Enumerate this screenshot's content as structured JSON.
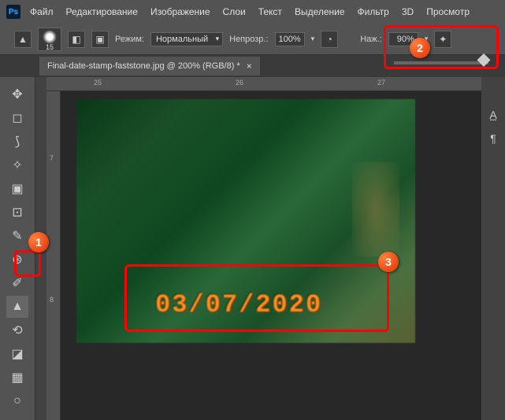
{
  "menu": {
    "items": [
      "Файл",
      "Редактирование",
      "Изображение",
      "Слои",
      "Текст",
      "Выделение",
      "Фильтр",
      "3D",
      "Просмотр"
    ]
  },
  "options": {
    "brush_size": "15",
    "mode_label": "Режим:",
    "mode_value": "Нормальный",
    "opacity_label": "Непрозр.:",
    "opacity_value": "100%",
    "flow_label": "Наж.:",
    "flow_value": "90%"
  },
  "tab": {
    "title": "Final-date-stamp-faststone.jpg @ 200% (RGB/8) *"
  },
  "ruler": {
    "h": [
      "25",
      "26",
      "27"
    ],
    "v": [
      "7",
      "8"
    ]
  },
  "canvas": {
    "date_stamp": "03/07/2020"
  },
  "markers": {
    "m1": "1",
    "m2": "2",
    "m3": "3"
  }
}
